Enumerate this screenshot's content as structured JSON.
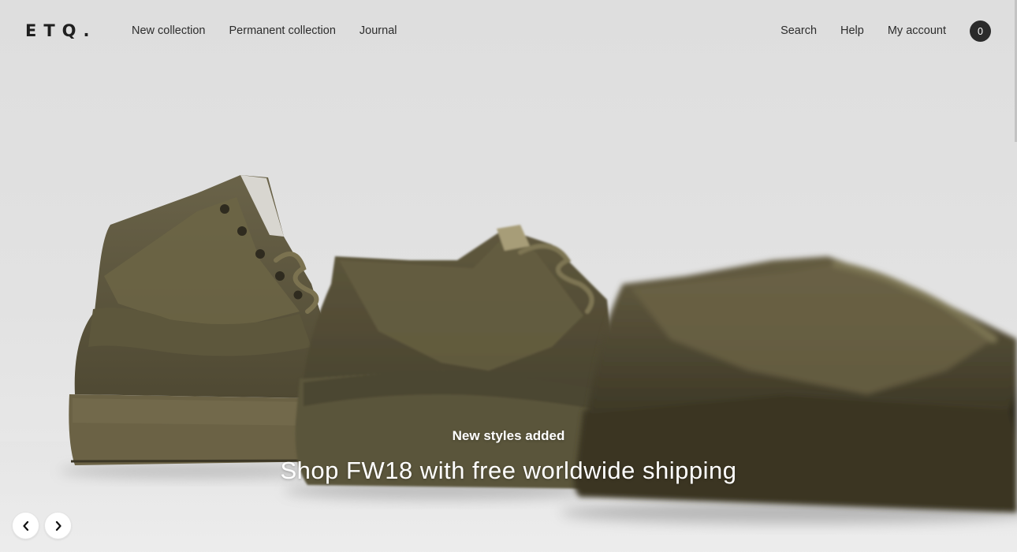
{
  "brand": {
    "logo": "ETQ."
  },
  "nav": {
    "left": [
      {
        "label": "New collection"
      },
      {
        "label": "Permanent collection"
      },
      {
        "label": "Journal"
      }
    ],
    "right": [
      {
        "label": "Search"
      },
      {
        "label": "Help"
      },
      {
        "label": "My account"
      }
    ],
    "cart_count": "0"
  },
  "hero": {
    "kicker": "New styles added",
    "headline": "Shop FW18 with free worldwide shipping",
    "image": "three olive-brown leather sneakers on light grey background",
    "colors": {
      "background": "#e1e1e1",
      "shoe": "#5b5439",
      "sole": "#6b6245",
      "caption_text": "#ffffff"
    }
  },
  "carousel": {
    "prev_icon": "chevron-left-icon",
    "next_icon": "chevron-right-icon"
  }
}
